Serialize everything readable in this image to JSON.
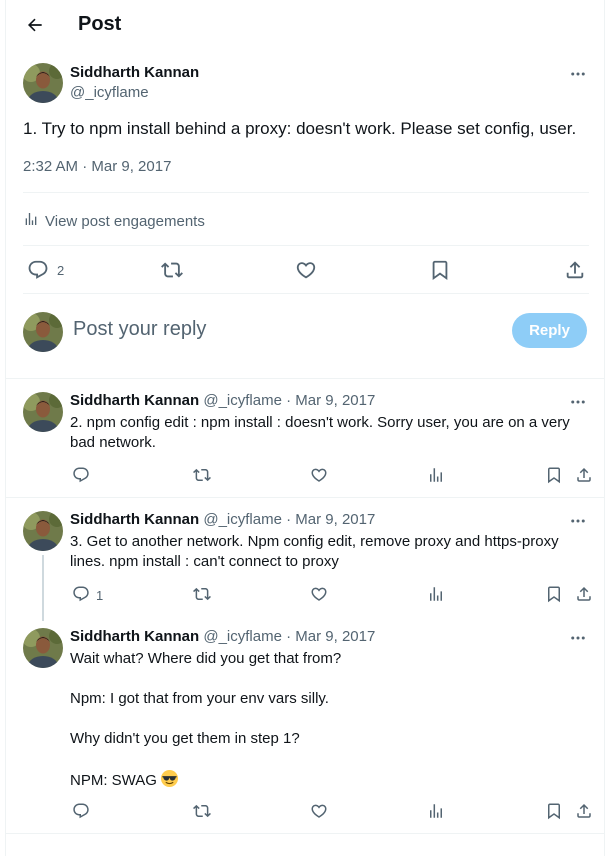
{
  "header": {
    "title": "Post"
  },
  "main_post": {
    "author_name": "Siddharth Kannan",
    "author_handle": "@_icyflame",
    "text": "1. Try to npm install behind a proxy: doesn't work. Please set config, user.",
    "timestamp": "2:32 AM · Mar 9, 2017",
    "engagements_label": "View post engagements",
    "reply_count": "2"
  },
  "composer": {
    "placeholder": "Post your reply",
    "reply_button": "Reply"
  },
  "replies": [
    {
      "author_name": "Siddharth Kannan",
      "author_handle": "@_icyflame",
      "date": "· Mar 9, 2017",
      "text": "2. npm config edit : npm install : doesn't work. Sorry user, you are on a very bad network.",
      "reply_count": ""
    },
    {
      "author_name": "Siddharth Kannan",
      "author_handle": "@_icyflame",
      "date": "· Mar 9, 2017",
      "text": "3. Get to another network. Npm config edit, remove proxy and https-proxy lines. npm install : can't connect to proxy",
      "reply_count": "1"
    },
    {
      "author_name": "Siddharth Kannan",
      "author_handle": "@_icyflame",
      "date": "· Mar 9, 2017",
      "lines": [
        "Wait what? Where did you get that from?",
        "Npm: I got that from your env vars silly.",
        "Why didn't you get them in step 1?",
        "NPM: SWAG"
      ],
      "emoji": "smiling-face-with-sunglasses",
      "reply_count": ""
    }
  ],
  "colors": {
    "text_primary": "#0f1419",
    "text_secondary": "#536471",
    "divider": "#eff3f4",
    "reply_button_disabled": "#8ecdf7",
    "thread_line": "#cfd9de"
  },
  "icons": [
    "back-arrow-icon",
    "more-icon",
    "analytics-icon",
    "reply-icon",
    "repost-icon",
    "like-icon",
    "bookmark-icon",
    "share-icon",
    "views-icon"
  ]
}
